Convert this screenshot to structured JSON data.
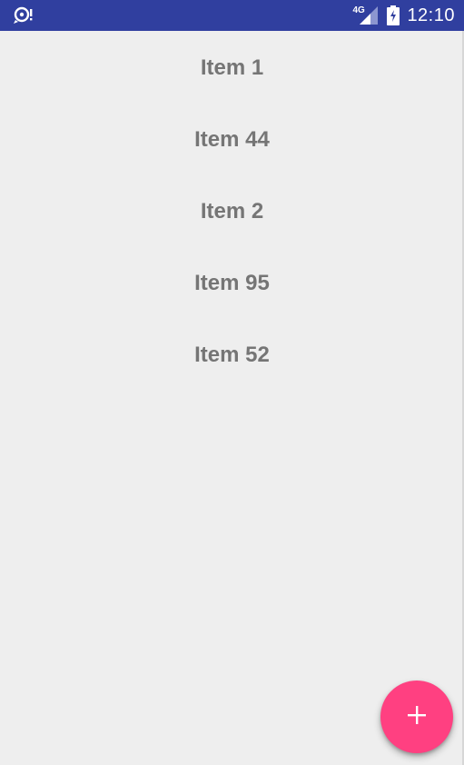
{
  "status_bar": {
    "network_label": "4G",
    "time": "12:10",
    "left_icon": "sync-notification-icon",
    "signal_icon": "cell-signal-icon",
    "battery_icon": "battery-charging-icon"
  },
  "list": {
    "items": [
      {
        "label": "Item 1"
      },
      {
        "label": "Item 44"
      },
      {
        "label": "Item 2"
      },
      {
        "label": "Item 95"
      },
      {
        "label": "Item 52"
      }
    ]
  },
  "fab": {
    "icon": "plus-icon"
  },
  "colors": {
    "status_bar_bg": "#303f9f",
    "background": "#eeeeee",
    "item_text": "#757575",
    "fab_bg": "#ff4081"
  }
}
